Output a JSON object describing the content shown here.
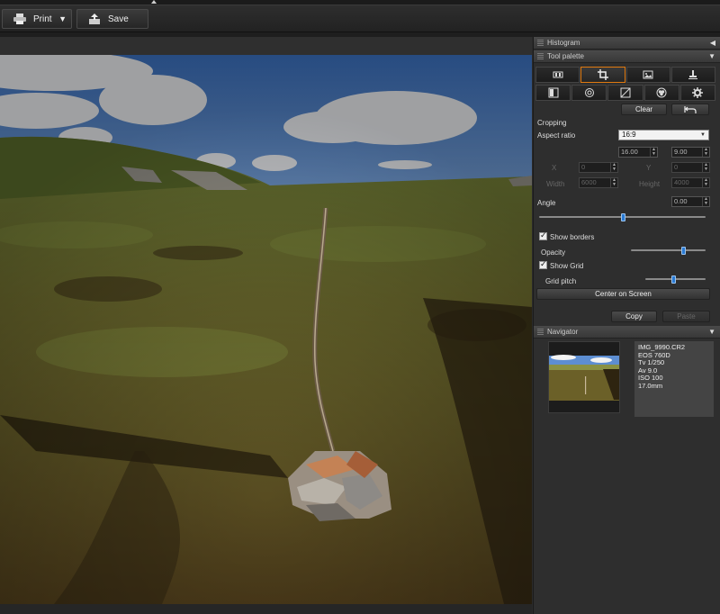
{
  "toolbar": {
    "print_label": "Print",
    "save_label": "Save"
  },
  "panels": {
    "histogram_title": "Histogram",
    "tool_palette_title": "Tool palette",
    "navigator_title": "Navigator"
  },
  "tool_palette": {
    "clear_label": "Clear",
    "section_title": "Cropping",
    "aspect_ratio_label": "Aspect ratio",
    "aspect_ratio_value": "16:9",
    "ratio_w": "16.00",
    "ratio_h": "9.00",
    "x_label": "X",
    "x_value": "0",
    "y_label": "Y",
    "y_value": "0",
    "width_label": "Width",
    "width_value": "6000",
    "height_label": "Height",
    "height_value": "4000",
    "angle_label": "Angle",
    "angle_value": "0.00",
    "angle_slider_level": 0.5,
    "show_borders_label": "Show borders",
    "show_borders_checked": true,
    "opacity_label": "Opacity",
    "opacity_level": 0.7,
    "show_grid_label": "Show Grid",
    "show_grid_checked": true,
    "grid_pitch_label": "Grid pitch",
    "grid_pitch_level": 0.47,
    "center_label": "Center on Screen",
    "copy_label": "Copy",
    "paste_label": "Paste"
  },
  "navigator": {
    "info": [
      "IMG_9990.CR2",
      "EOS 760D",
      "Tv 1/250",
      "Av 9.0",
      "ISO 100",
      "17.0mm"
    ]
  },
  "colors": {
    "accent_orange": "#e07a10",
    "slider_blue": "#2a7bd4",
    "panel_bg": "#2e2e2e"
  },
  "icons": {
    "print": "printer-icon",
    "save": "save-icon",
    "undo": "undo-icon"
  }
}
